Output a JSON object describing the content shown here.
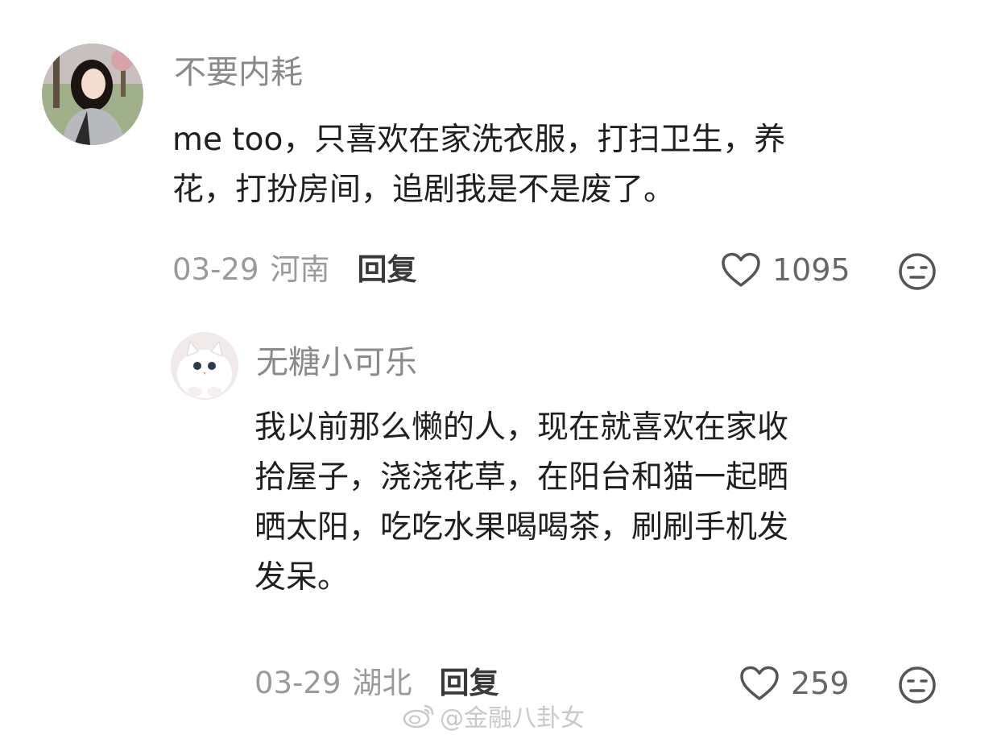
{
  "comments": [
    {
      "username": "不要内耗",
      "line1": "me too，只喜欢在家洗衣服，打扫卫生，养",
      "line2": "花，打扮房间，追剧我是不是废了。",
      "date": "03-29",
      "location": "河南",
      "reply_label": "回复",
      "likes": "1095",
      "avatar_icon": "user-photo-avatar"
    },
    {
      "username": "无糖小可乐",
      "line1": "我以前那么懒的人，现在就喜欢在家收",
      "line2": "拾屋子，浇浇花草，在阳台和猫一起晒",
      "line3": "晒太阳，吃吃水果喝喝茶，刷刷手机发",
      "line4": "发呆。",
      "date": "03-29",
      "location": "湖北",
      "reply_label": "回复",
      "likes": "259",
      "avatar_icon": "kitten-photo-avatar"
    }
  ],
  "icons": {
    "like": "heart-icon",
    "dislike": "neutral-face-icon"
  },
  "watermark": {
    "text": "@金融八卦女",
    "icon": "weibo-logo-icon"
  },
  "colors": {
    "name": "#8a8a8a",
    "text": "#1f1f1f",
    "meta": "#9a9a9a",
    "icon": "#555555"
  }
}
